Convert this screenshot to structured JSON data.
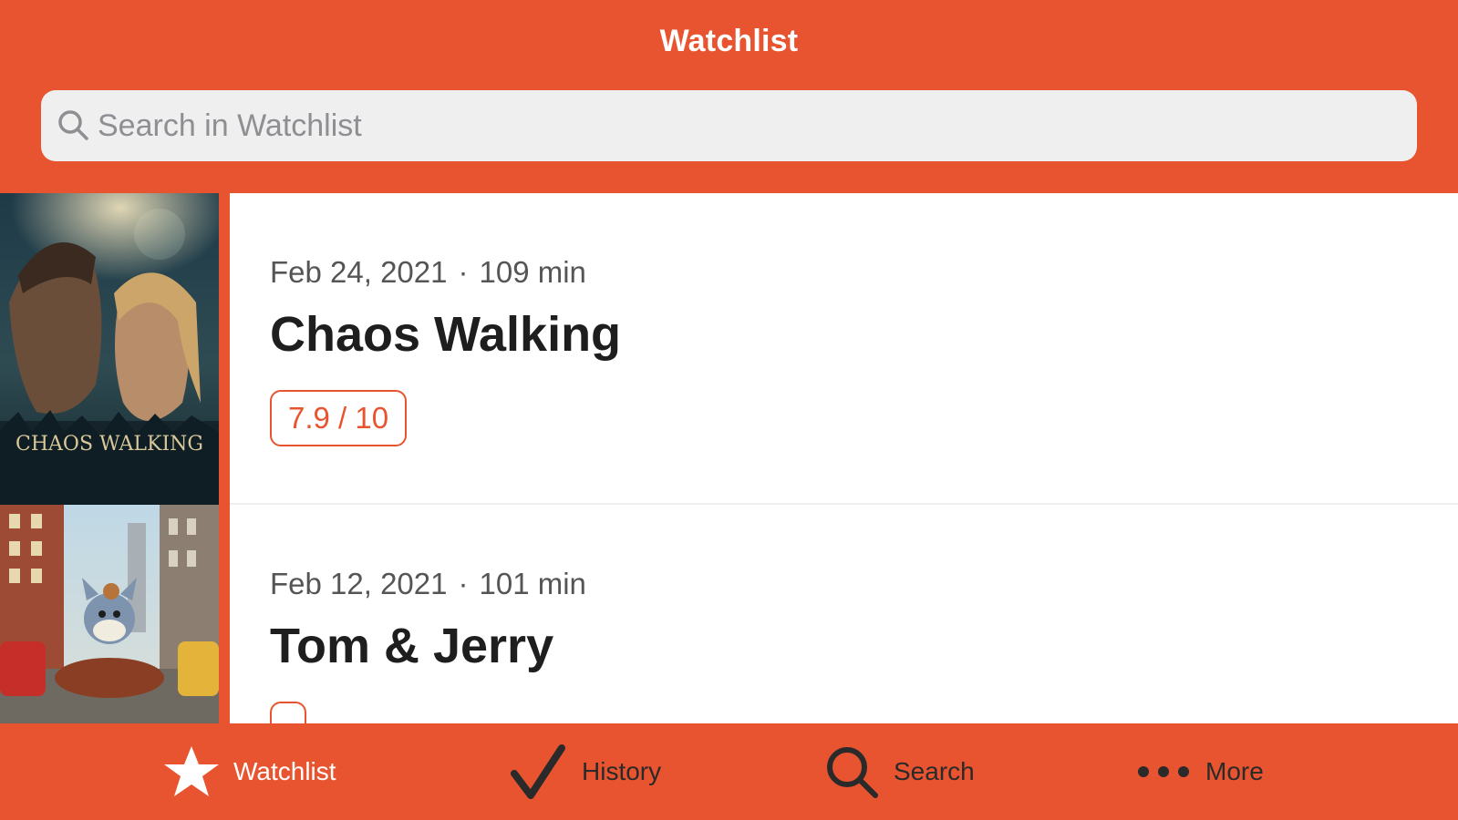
{
  "header": {
    "title": "Watchlist"
  },
  "search": {
    "placeholder": "Search in Watchlist",
    "value": ""
  },
  "movies": [
    {
      "date": "Feb 24, 2021",
      "separator": "·",
      "duration": "109 min",
      "title": "Chaos Walking",
      "rating": "7.9 / 10",
      "poster_text": "CHAOS WALKING"
    },
    {
      "date": "Feb 12, 2021",
      "separator": "·",
      "duration": "101 min",
      "title": "Tom & Jerry",
      "rating": "",
      "poster_text": ""
    }
  ],
  "tabs": [
    {
      "label": "Watchlist",
      "icon": "star-icon",
      "active": true
    },
    {
      "label": "History",
      "icon": "checkmark-icon",
      "active": false
    },
    {
      "label": "Search",
      "icon": "search-icon",
      "active": false
    },
    {
      "label": "More",
      "icon": "more-dots-icon",
      "active": false
    }
  ],
  "colors": {
    "accent": "#E8542F",
    "card": "#FFFFFF",
    "search_bg": "#EFEFF0",
    "text_dark": "#1E1E1E",
    "tab_inactive": "#2A2A2A"
  }
}
